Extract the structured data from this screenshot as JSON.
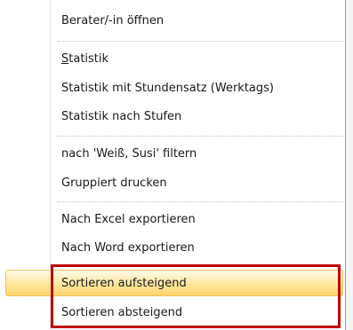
{
  "menu": {
    "items": [
      {
        "label": "Berater/-in öffnen"
      },
      {
        "label": "Statistik",
        "mnemonic": "S",
        "rest": "tatistik"
      },
      {
        "label": "Statistik mit Stundensatz (Werktags)"
      },
      {
        "label": "Statistik nach Stufen"
      },
      {
        "label": "nach 'Weiß, Susi' filtern"
      },
      {
        "label": "Gruppiert drucken"
      },
      {
        "label": "Nach Excel exportieren"
      },
      {
        "label": "Nach Word exportieren"
      },
      {
        "label": "Sortieren aufsteigend"
      },
      {
        "label": "Sortieren absteigend"
      }
    ],
    "hovered_item": "Sortieren aufsteigend"
  },
  "colors": {
    "hover_top": "#fffbe8",
    "hover_bottom": "#fed46a",
    "hover_border": "#f1c15f",
    "annotation_box": "#c00000",
    "separator": "#c5c5c5"
  }
}
